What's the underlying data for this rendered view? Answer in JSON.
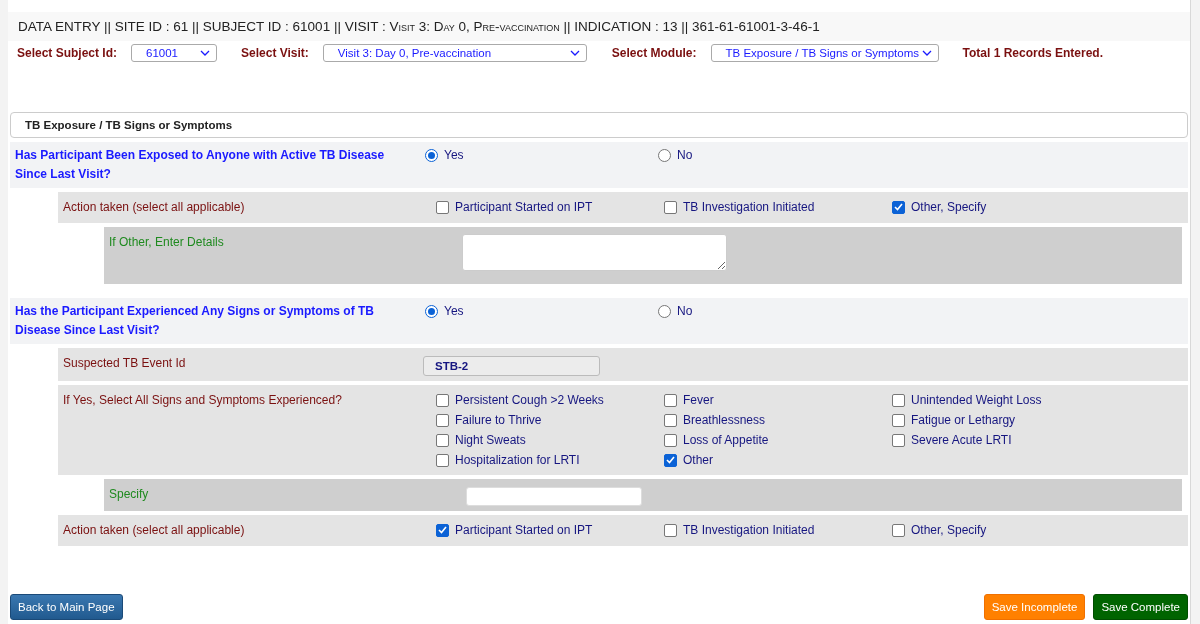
{
  "header": {
    "prefix": "DATA ENTRY  ||  SITE ID : 61 || SUBJECT ID : 61001 || VISIT :",
    "visit": "Visit 3: Day 0, Pre-vaccination",
    "suffix": "|| INDICATION : 13 || 361-61-61001-3-46-1"
  },
  "selectors": [
    {
      "label": "Select Subject Id:",
      "value": "61001"
    },
    {
      "label": "Select Visit:",
      "value": "Visit 3: Day 0, Pre-vaccination"
    },
    {
      "label": "Select Module:",
      "value": "TB Exposure / TB Signs or Symptoms"
    }
  ],
  "records_note": "Total 1 Records Entered.",
  "section_title": "TB Exposure / TB Signs or Symptoms",
  "rows": [
    {
      "kind": "radio",
      "label": "Has Participant Been Exposed to Anyone with Active TB Disease Since Last Visit?",
      "options": [
        {
          "label": "Yes",
          "selected": true
        },
        {
          "label": "No",
          "selected": false
        }
      ],
      "children": [
        {
          "kind": "checkboxes",
          "label": "Action taken (select all applicable)",
          "options": [
            {
              "label": "Participant Started on IPT",
              "checked": false
            },
            {
              "label": "TB Investigation Initiated",
              "checked": false
            },
            {
              "label": "Other, Specify",
              "checked": true
            }
          ],
          "children": [
            {
              "kind": "textarea",
              "label": "If Other, Enter Details"
            }
          ]
        }
      ]
    },
    {
      "kind": "radio",
      "label": "Has the Participant Experienced Any Signs or Symptoms of TB Disease Since Last Visit?",
      "options": [
        {
          "label": "Yes",
          "selected": true
        },
        {
          "label": "No",
          "selected": false
        }
      ],
      "children": [
        {
          "kind": "readonly",
          "label": "Suspected TB Event Id",
          "value": "STB-2"
        },
        {
          "kind": "checkboxes",
          "label": "If Yes, Select All Signs and Symptoms Experienced?",
          "options": [
            {
              "label": "Persistent Cough >2 Weeks",
              "checked": false
            },
            {
              "label": "Fever",
              "checked": false
            },
            {
              "label": "Unintended Weight Loss",
              "checked": false
            },
            {
              "label": "Failure to Thrive",
              "checked": false
            },
            {
              "label": "Breathlessness",
              "checked": false
            },
            {
              "label": "Fatigue or Lethargy",
              "checked": false
            },
            {
              "label": "Night Sweats",
              "checked": false
            },
            {
              "label": "Loss of Appetite",
              "checked": false
            },
            {
              "label": "Severe Acute LRTI",
              "checked": false
            },
            {
              "label": "Hospitalization for LRTI",
              "checked": false
            },
            {
              "label": "Other",
              "checked": true
            }
          ],
          "children": [
            {
              "kind": "text",
              "label": "Specify"
            }
          ]
        },
        {
          "kind": "checkboxes",
          "label": "Action taken (select all applicable)",
          "options": [
            {
              "label": "Participant Started on IPT",
              "checked": true
            },
            {
              "label": "TB Investigation Initiated",
              "checked": false
            },
            {
              "label": "Other, Specify",
              "checked": false
            }
          ]
        }
      ]
    }
  ],
  "buttons": [
    {
      "label": "Back to Main Page",
      "kind": "back"
    },
    {
      "label": "Save Incomplete",
      "kind": "incomplete"
    },
    {
      "label": "Save Complete",
      "kind": "complete"
    }
  ]
}
